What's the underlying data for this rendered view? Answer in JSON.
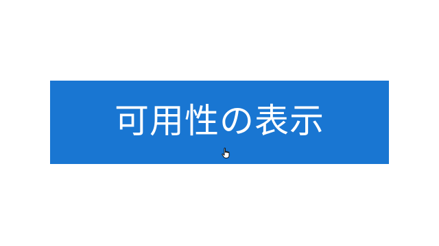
{
  "main": {
    "button_label": "可用性の表示"
  },
  "theme": {
    "background": "#ffffff",
    "button_color": "#1976d2",
    "label_color": "#ffffff"
  },
  "cursor": {
    "icon": "hand-pointer-icon"
  }
}
